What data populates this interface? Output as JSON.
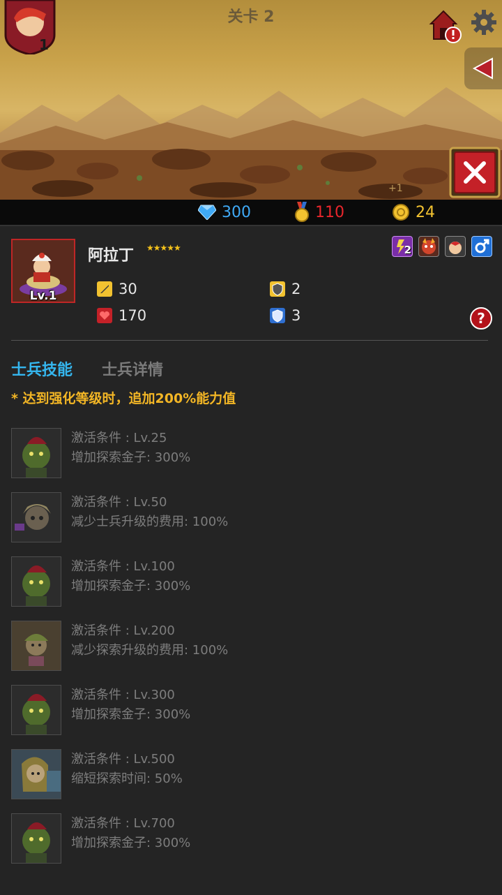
{
  "stage": {
    "title": "关卡 2",
    "hero_level": "1",
    "bonus_text": "+1"
  },
  "resources": {
    "gems": {
      "icon": "diamond-icon",
      "value": "300",
      "color": "#3fa9f5"
    },
    "medals": {
      "icon": "medal-icon",
      "value": "110",
      "color": "#e8262c"
    },
    "coins": {
      "icon": "coin-icon",
      "value": "24",
      "color": "#f2c230"
    }
  },
  "unit": {
    "name": "阿拉丁",
    "stars": "★★★★★",
    "level_label": "Lv.1",
    "attack": "30",
    "hp": "170",
    "armor": "2",
    "magic_resist": "3",
    "trait_badge": "2",
    "trait_icons": [
      "lightning-icon",
      "monster-face-icon",
      "hero-face-icon",
      "male-icon"
    ]
  },
  "tabs": {
    "skills": "士兵技能",
    "details": "士兵详情"
  },
  "note": "* 达到强化等级时，追加200%能力值",
  "skills": [
    {
      "condition": "激活条件 : Lv.25",
      "effect": "增加探索金子: 300%",
      "icon": "goblin-portrait-icon"
    },
    {
      "condition": "激活条件 : Lv.50",
      "effect": "减少士兵升级的费用: 100%",
      "icon": "elf-girl-portrait-icon"
    },
    {
      "condition": "激活条件 : Lv.100",
      "effect": "增加探索金子: 300%",
      "icon": "goblin-portrait-icon"
    },
    {
      "condition": "激活条件 : Lv.200",
      "effect": "减少探索升级的费用: 100%",
      "icon": "fairy-portrait-icon"
    },
    {
      "condition": "激活条件 : Lv.300",
      "effect": "增加探索金子: 300%",
      "icon": "goblin-portrait-icon"
    },
    {
      "condition": "激活条件 : Lv.500",
      "effect": "缩短探索时间: 50%",
      "icon": "mermaid-portrait-icon"
    },
    {
      "condition": "激活条件 : Lv.700",
      "effect": "增加探索金子: 300%",
      "icon": "goblin-portrait-icon"
    }
  ]
}
